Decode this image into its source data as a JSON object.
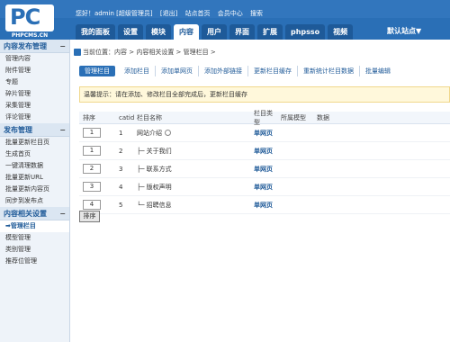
{
  "brand": {
    "logo": "PC",
    "domain": "PHPCMS.CN"
  },
  "header": {
    "greeting": "您好！admin [超级管理员]",
    "logout": "[退出]",
    "site_home": "站点首页",
    "member_center": "会员中心",
    "search": "搜索",
    "site_select": "默认站点▼",
    "nav": [
      "我的面板",
      "设置",
      "模块",
      "内容",
      "用户",
      "界面",
      "扩展",
      "phpsso",
      "视频"
    ],
    "active_nav": "内容"
  },
  "sidebar": {
    "sections": [
      {
        "title": "内容发布管理",
        "items": [
          "管理内容",
          "附件管理",
          "专题",
          "碎片管理",
          "采集管理",
          "评论管理"
        ]
      },
      {
        "title": "发布管理",
        "items": [
          "批量更新栏目页",
          "生成首页",
          "一键清理数据",
          "批量更新URL",
          "批量更新内容页",
          "同步到发布点"
        ]
      },
      {
        "title": "内容相关设置",
        "items": [
          "管理栏目",
          "模型管理",
          "类别管理",
          "推荐位管理"
        ]
      }
    ],
    "active_item": "管理栏目"
  },
  "breadcrumb": "当前位置：内容 > 内容相关设置 > 管理栏目 >",
  "toolbar": [
    "管理栏目",
    "添加栏目",
    "添加单网页",
    "添加外部链接",
    "更新栏目缓存",
    "重新统计栏目数据",
    "批量编辑"
  ],
  "notice": "温馨提示：请在添加、修改栏目全部完成后，更新栏目缓存",
  "table": {
    "headers": [
      "排序",
      "catid",
      "栏目名称",
      "栏目类型",
      "所属模型",
      "数据"
    ],
    "rows": [
      {
        "order": "1",
        "catid": "1",
        "name": "网站介绍",
        "type": "单网页",
        "prefix": ""
      },
      {
        "order": "1",
        "catid": "2",
        "name": "关于我们",
        "type": "单网页",
        "prefix": "├─"
      },
      {
        "order": "2",
        "catid": "3",
        "name": "联系方式",
        "type": "单网页",
        "prefix": "├─"
      },
      {
        "order": "3",
        "catid": "4",
        "name": "版权声明",
        "type": "单网页",
        "prefix": "├─"
      },
      {
        "order": "4",
        "catid": "5",
        "name": "招聘信息",
        "type": "单网页",
        "prefix": "└─"
      }
    ]
  },
  "buttons": {
    "sort": "排序"
  },
  "colors": {
    "brand": "#2a6fb6",
    "nav_dark": "#1e5a99",
    "notice_bg": "#fff8db",
    "link": "#1f5a98"
  }
}
